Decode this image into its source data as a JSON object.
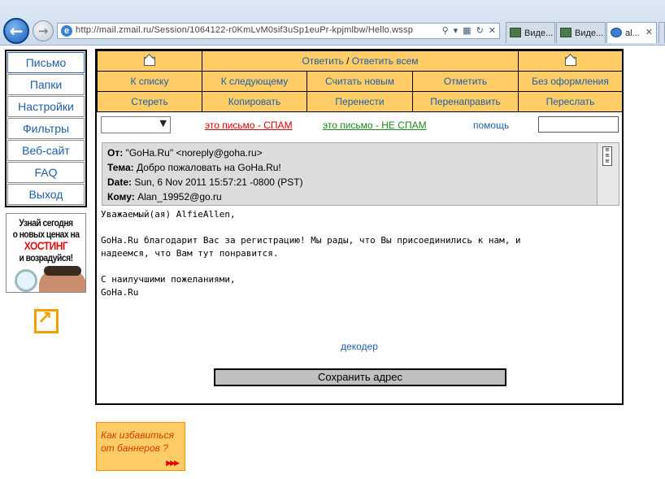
{
  "browser": {
    "address": "http://mail.zmail.ru/Session/1064122-r0KmLvM0sif3uSp1euPr-kpjmlbw/Hello.wssp",
    "tabs": [
      {
        "label": "Виде...",
        "icon": "video-page-icon"
      },
      {
        "label": "Виде...",
        "icon": "video-page-icon"
      },
      {
        "label": "al...",
        "icon": "ie-page-icon",
        "active": true
      }
    ]
  },
  "sidebar": {
    "items": [
      {
        "label": "Письмо"
      },
      {
        "label": "Папки"
      },
      {
        "label": "Настройки"
      },
      {
        "label": "Фильтры"
      },
      {
        "label": "Веб-сайт"
      },
      {
        "label": "FAQ"
      },
      {
        "label": "Выход"
      }
    ],
    "ad": {
      "line1": "Узнай сегодня",
      "line2": "о новых ценах на",
      "line3": "ХОСТИНГ",
      "line4": "и возрадуйся!"
    }
  },
  "toolbar": {
    "reply": "Ответить",
    "separator": "/",
    "reply_all": "Ответить всем",
    "to_list": "К списку",
    "next": "К следующему",
    "mark_new": "Считать новым",
    "mark": "Отметить",
    "no_format": "Без оформления",
    "delete": "Стереть",
    "copy": "Копировать",
    "move": "Перенести",
    "redirect": "Перенаправить",
    "forward": "Переслать"
  },
  "spam_row": {
    "spam": "это письмо - СПАМ",
    "not_spam": "это письмо - НЕ СПАМ",
    "help": "помощь",
    "folder_value": ""
  },
  "headers": {
    "from_label": "От:",
    "from_value": "\"GoHa.Ru\" <noreply@goha.ru>",
    "subject_label": "Тема:",
    "subject_value": "Добро пожаловать на GoHa.Ru!",
    "date_label": "Date:",
    "date_value": "Sun, 6 Nov 2011 15:57:21 -0800 (PST)",
    "to_label": "Кому:",
    "to_value": "Alan_19952@go.ru"
  },
  "message": {
    "body": "Уважаемый(ая) AlfieAllen,\n\nGoHa.Ru благодарит Вас за регистрацию! Мы рады, что Вы присоединились к нам, и\nнадеемся, что Вам тут понравится.\n\nС наилучшими пожеланиями,\nGoHa.Ru"
  },
  "decoder": "декодер",
  "save_address": "Сохранить адрес",
  "banner_link": {
    "text": "Как избавиться от баннеров ?",
    "arrows": "▶▶▶"
  },
  "colors": {
    "toolbar_bg": "#ffcc66",
    "link": "#1f5ea8",
    "spam": "#d90000",
    "not_spam": "#1a8a1a"
  }
}
